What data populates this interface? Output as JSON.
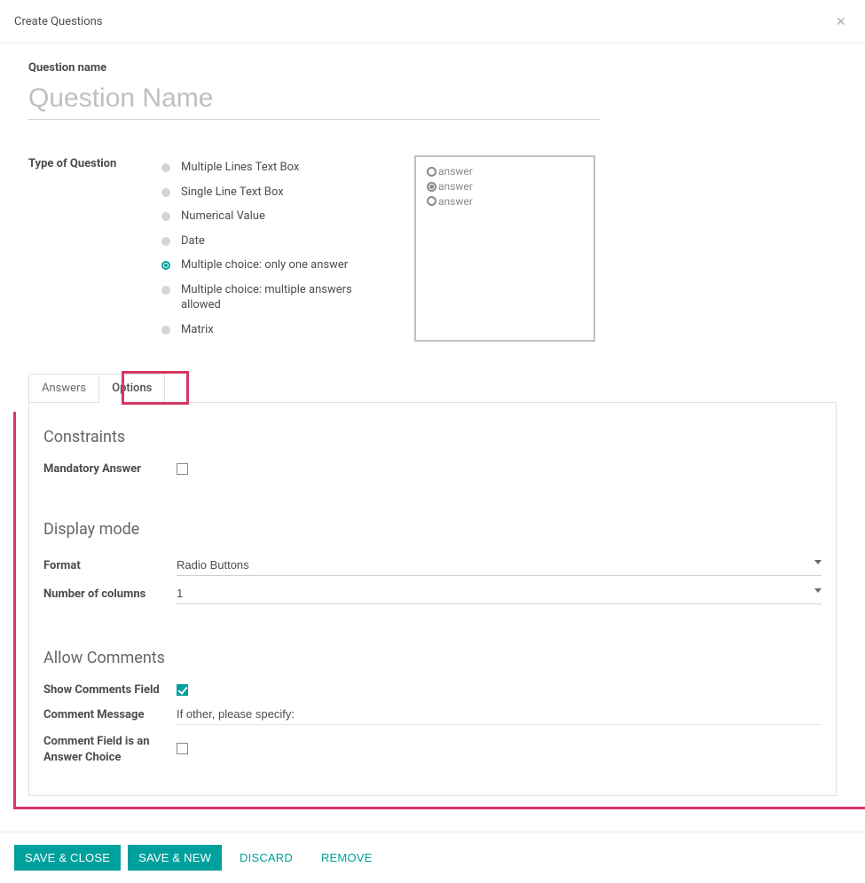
{
  "modal": {
    "title": "Create Questions"
  },
  "question": {
    "name_label": "Question name",
    "name_placeholder": "Question Name",
    "name_value": ""
  },
  "type": {
    "label": "Type of Question",
    "options": [
      {
        "label": "Multiple Lines Text Box",
        "selected": false
      },
      {
        "label": "Single Line Text Box",
        "selected": false
      },
      {
        "label": "Numerical Value",
        "selected": false
      },
      {
        "label": "Date",
        "selected": false
      },
      {
        "label": "Multiple choice: only one answer",
        "selected": true
      },
      {
        "label": "Multiple choice: multiple answers allowed",
        "selected": false
      },
      {
        "label": "Matrix",
        "selected": false
      }
    ]
  },
  "preview": {
    "rows": [
      {
        "label": "answer",
        "filled": false
      },
      {
        "label": "answer",
        "filled": true
      },
      {
        "label": "answer",
        "filled": false
      }
    ]
  },
  "tabs": {
    "items": [
      {
        "label": "Answers",
        "active": false
      },
      {
        "label": "Options",
        "active": true
      }
    ]
  },
  "constraints": {
    "title": "Constraints",
    "mandatory_label": "Mandatory Answer",
    "mandatory_checked": false
  },
  "display": {
    "title": "Display mode",
    "format_label": "Format",
    "format_value": "Radio Buttons",
    "columns_label": "Number of columns",
    "columns_value": "1"
  },
  "comments": {
    "title": "Allow Comments",
    "show_label": "Show Comments Field",
    "show_checked": true,
    "msg_label": "Comment Message",
    "msg_value": "If other, please specify:",
    "choice_label": "Comment Field is an Answer Choice",
    "choice_checked": false
  },
  "footer": {
    "save_close": "Save & Close",
    "save_new": "Save & New",
    "discard": "Discard",
    "remove": "Remove"
  }
}
